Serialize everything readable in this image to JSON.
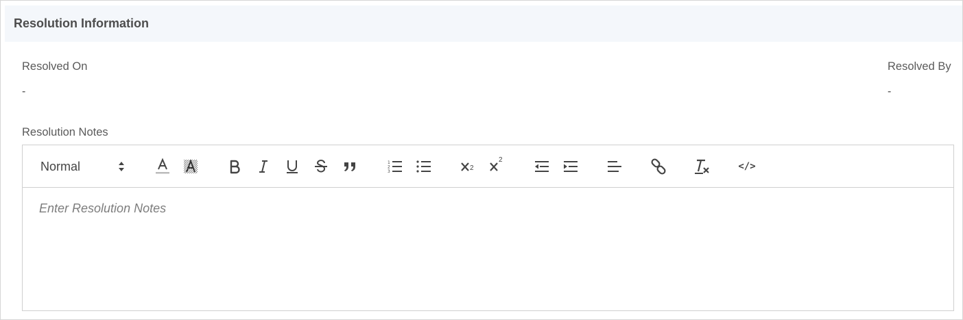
{
  "section": {
    "title": "Resolution Information"
  },
  "fields": {
    "resolved_on": {
      "label": "Resolved On",
      "value": "-"
    },
    "resolved_by": {
      "label": "Resolved By",
      "value": "-"
    }
  },
  "notes": {
    "label": "Resolution Notes",
    "placeholder": "Enter Resolution Notes"
  },
  "toolbar": {
    "format_selected": "Normal",
    "code_glyph": "</>",
    "sub_digit": "2",
    "sup_digit": "2"
  },
  "colors": {
    "header_bg": "#f4f7fb",
    "border": "#cfcfcf",
    "icon": "#444444"
  }
}
